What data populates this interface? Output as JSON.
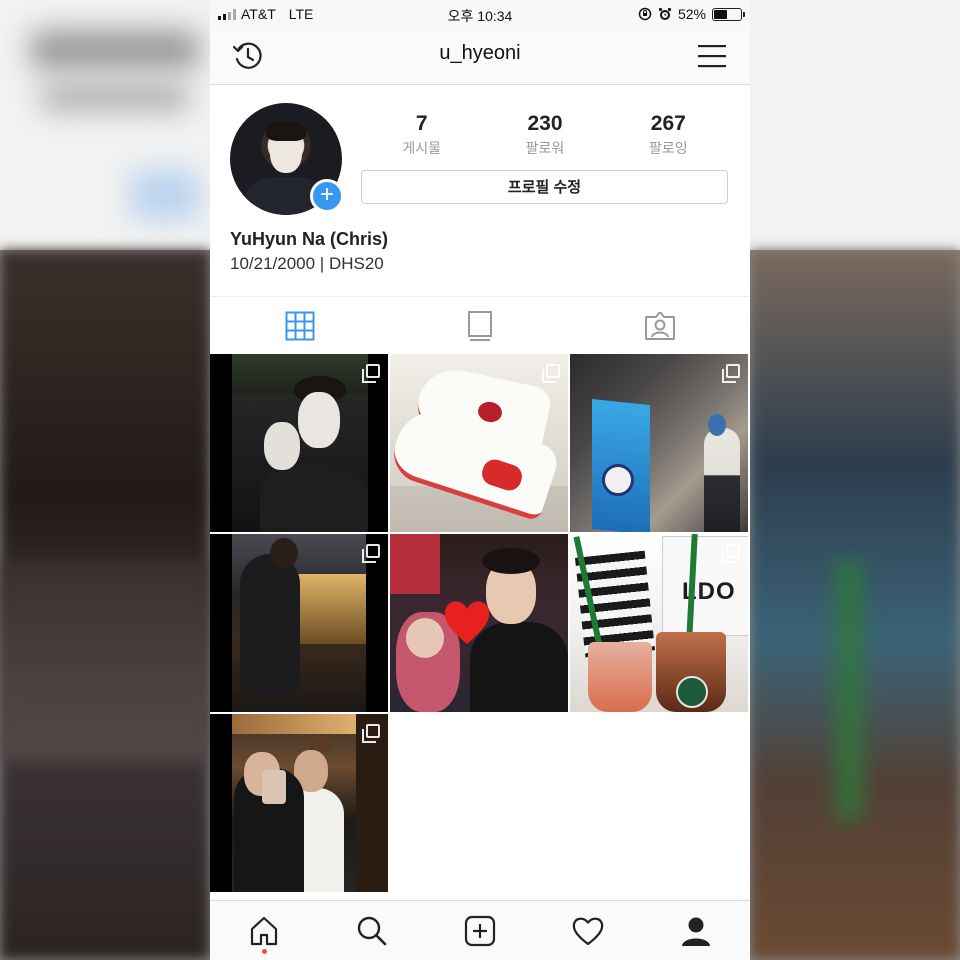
{
  "status_bar": {
    "carrier": "AT&T",
    "network": "LTE",
    "time": "오후 10:34",
    "battery": "52%",
    "battery_level": 0.52
  },
  "header": {
    "username": "u_hyeoni",
    "left_icon": "history-icon",
    "right_icon": "hamburger-menu-icon"
  },
  "profile": {
    "stats": [
      {
        "count": "7",
        "label": "게시물"
      },
      {
        "count": "230",
        "label": "팔로워"
      },
      {
        "count": "267",
        "label": "팔로잉"
      }
    ],
    "edit_button": "프로필 수정",
    "name": "YuHyun Na (Chris)",
    "bio": "10/21/2000 | DHS20",
    "add_badge": "+"
  },
  "tabs": [
    {
      "icon": "grid-icon",
      "active": true
    },
    {
      "icon": "igtv-icon",
      "active": false
    },
    {
      "icon": "tagged-icon",
      "active": false
    }
  ],
  "posts": [
    {
      "multi": true
    },
    {
      "multi": true
    },
    {
      "multi": true
    },
    {
      "multi": true
    },
    {
      "multi": false
    },
    {
      "multi": true
    },
    {
      "multi": true
    }
  ],
  "post_text": {
    "bag_label": "LDO"
  },
  "bottom_nav": [
    {
      "icon": "home-icon",
      "notification_dot": true
    },
    {
      "icon": "search-icon"
    },
    {
      "icon": "new-post-icon"
    },
    {
      "icon": "heart-icon"
    },
    {
      "icon": "profile-icon"
    }
  ],
  "colors": {
    "accent": "#3897f0",
    "notification": "#ed4956",
    "divider": "#dbdbdb"
  }
}
